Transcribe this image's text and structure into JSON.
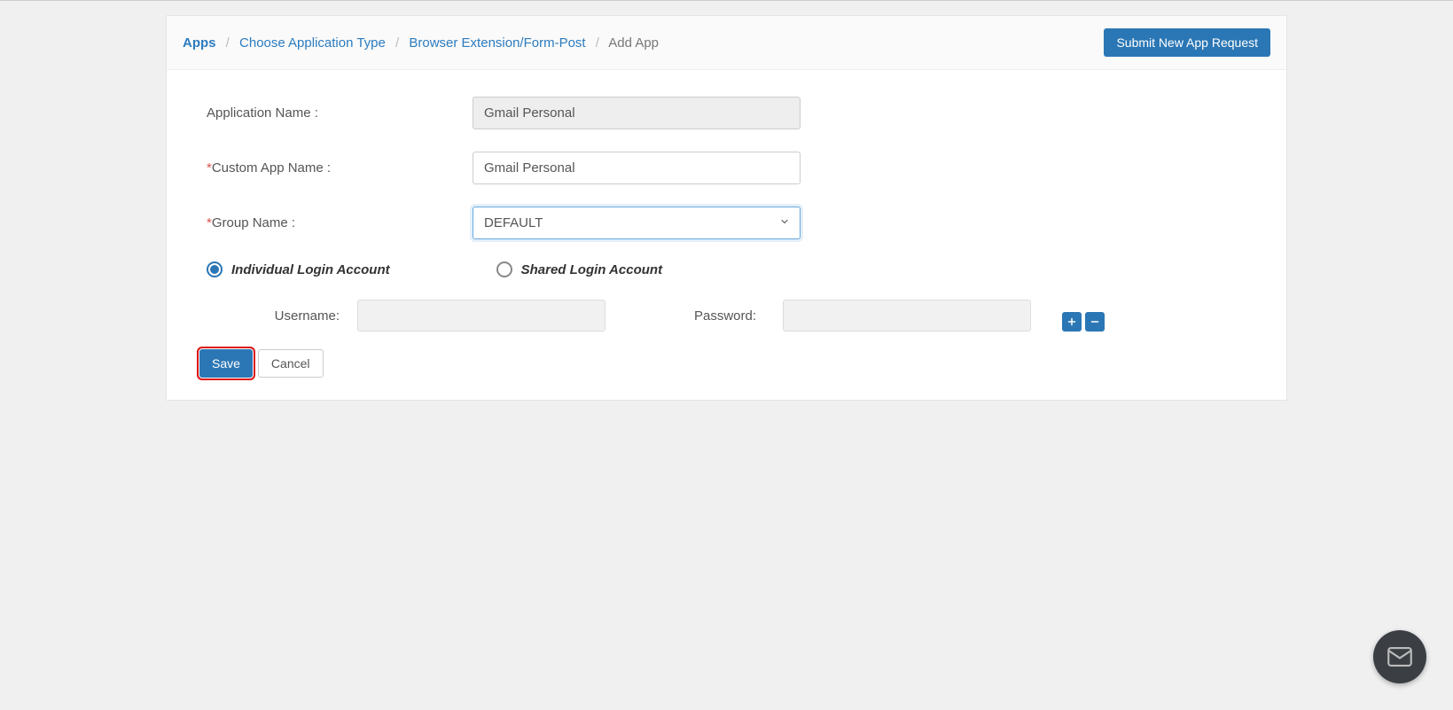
{
  "breadcrumb": {
    "items": [
      {
        "label": "Apps"
      },
      {
        "label": "Choose Application Type"
      },
      {
        "label": "Browser Extension/Form-Post"
      }
    ],
    "current": "Add App"
  },
  "header": {
    "submit_button": "Submit New App Request"
  },
  "form": {
    "app_name_label": "Application Name :",
    "app_name_value": "Gmail Personal",
    "custom_name_label": "Custom App Name :",
    "custom_name_value": "Gmail Personal",
    "group_name_label": "Group Name :",
    "group_name_value": "DEFAULT"
  },
  "login_options": {
    "individual": "Individual Login Account",
    "shared": "Shared Login Account"
  },
  "credentials": {
    "username_label": "Username:",
    "password_label": "Password:",
    "username_value": "",
    "password_value": ""
  },
  "actions": {
    "save": "Save",
    "cancel": "Cancel"
  }
}
